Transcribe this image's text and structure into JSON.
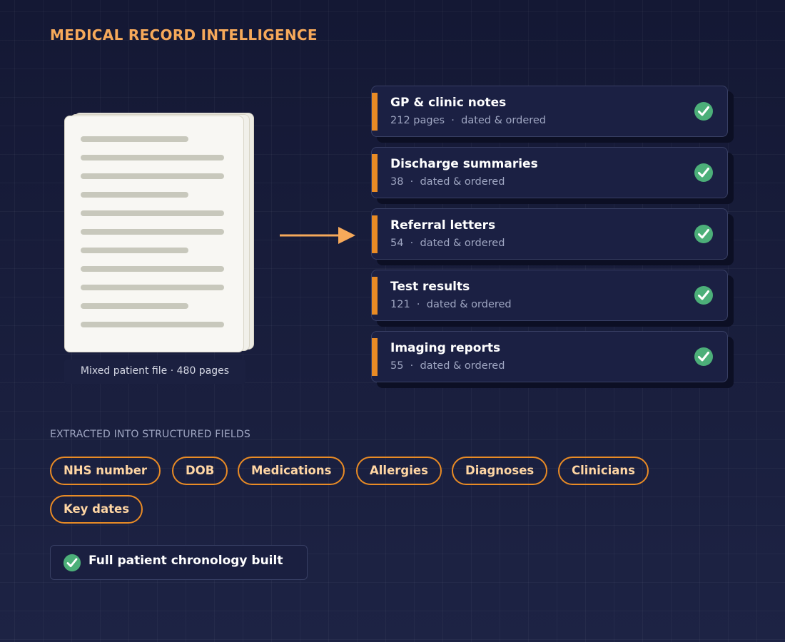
{
  "title": "MEDICAL RECORD INTELLIGENCE",
  "source": {
    "caption": "Mixed patient file · 480 pages"
  },
  "categories": [
    {
      "name": "GP & clinic notes",
      "count": "212 pages",
      "status": "dated & ordered",
      "icon": "check-circle-icon"
    },
    {
      "name": "Discharge summaries",
      "count": "38",
      "status": "dated & ordered",
      "icon": "check-circle-icon"
    },
    {
      "name": "Referral letters",
      "count": "54",
      "status": "dated & ordered",
      "icon": "check-circle-icon"
    },
    {
      "name": "Test results",
      "count": "121",
      "status": "dated & ordered",
      "icon": "check-circle-icon"
    },
    {
      "name": "Imaging reports",
      "count": "55",
      "status": "dated & ordered",
      "icon": "check-circle-icon"
    }
  ],
  "fields": {
    "label": "EXTRACTED INTO STRUCTURED FIELDS",
    "items": [
      "NHS number",
      "DOB",
      "Medications",
      "Allergies",
      "Diagnoses",
      "Clinicians",
      "Key dates"
    ]
  },
  "result": {
    "text": "Full patient chronology built",
    "icon": "check-circle-icon"
  },
  "colors": {
    "accent": "#e98b25",
    "title": "#f6a95a",
    "success": "#4caf79",
    "card_bg": "#1b2043",
    "background": "#161a36"
  }
}
